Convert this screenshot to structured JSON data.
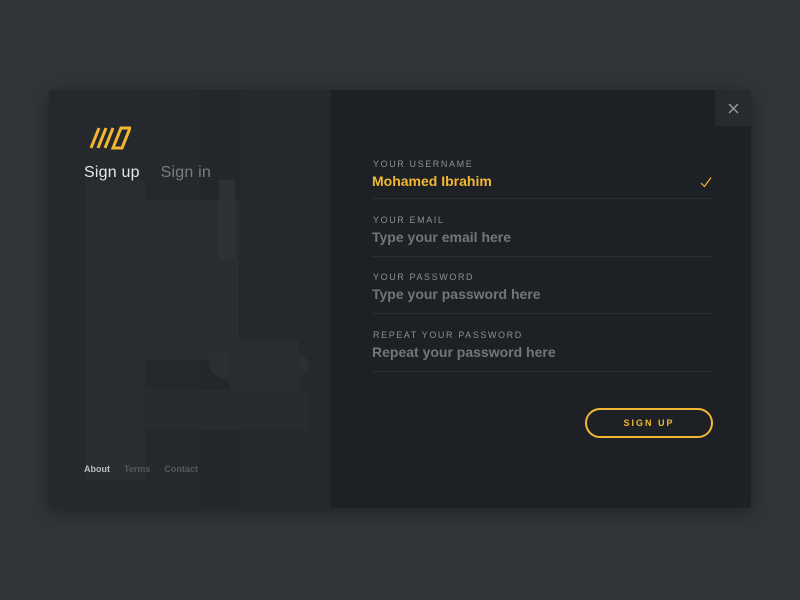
{
  "colors": {
    "accent": "#f3b731",
    "background": "#30353a",
    "panel": "#1d2024",
    "left_panel": "#25282c"
  },
  "logo": {
    "icon": "logo-stripes-icon"
  },
  "auth_tabs": [
    {
      "label": "Sign up",
      "active": true
    },
    {
      "label": "Sign in",
      "active": false
    }
  ],
  "footer_links": [
    {
      "label": "About",
      "active": true
    },
    {
      "label": "Terms",
      "active": false
    },
    {
      "label": "Contact",
      "active": false
    }
  ],
  "close": {
    "icon": "close-icon"
  },
  "form": {
    "username": {
      "label": "YOUR USERNAME",
      "value": "Mohamed Ibrahim",
      "status_icon": "check-icon"
    },
    "email": {
      "label": "YOUR EMAIL",
      "placeholder": "Type your email here"
    },
    "password": {
      "label": "YOUR PASSWORD",
      "placeholder": "Type your password here"
    },
    "repeat_password": {
      "label": "REPEAT YOUR PASSWORD",
      "placeholder": "Repeat your password here"
    },
    "submit_label": "SIGN UP"
  }
}
